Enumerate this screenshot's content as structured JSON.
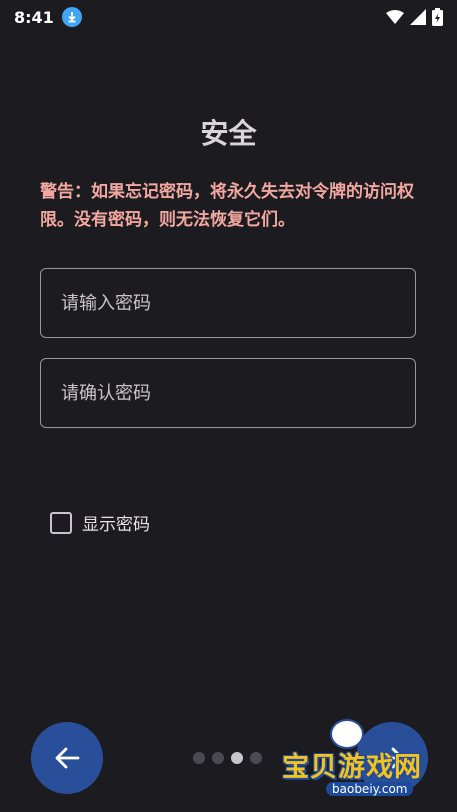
{
  "status_bar": {
    "time": "8:41",
    "icons": [
      "download-icon",
      "wifi-icon",
      "signal-icon",
      "battery-charging-icon"
    ]
  },
  "screen": {
    "title": "安全",
    "warning": "警告：如果忘记密码，将永久失去对令牌的访问权限。没有密码，则无法恢复它们。"
  },
  "form": {
    "password_placeholder": "请输入密码",
    "password_value": "",
    "confirm_placeholder": "请确认密码",
    "confirm_value": "",
    "show_password_label": "显示密码",
    "show_password_checked": false
  },
  "navigation": {
    "back_icon": "arrow-left-icon",
    "next_icon": "arrow-right-icon",
    "page_count": 4,
    "current_page": 3
  },
  "watermark": {
    "text": "宝贝游戏网",
    "url": "baobeiy.com"
  },
  "colors": {
    "background": "#1c1b20",
    "warning": "#f2a8a0",
    "primary": "#2a4f9a"
  }
}
